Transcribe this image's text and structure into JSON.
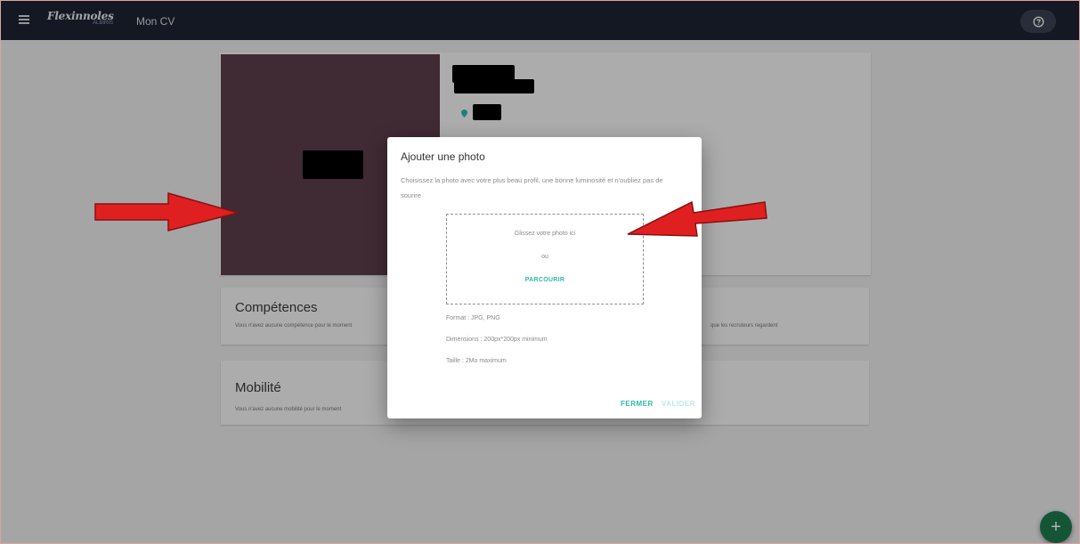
{
  "header": {
    "brand_main": "Flexinnoles",
    "brand_sub": "ALBIRIS",
    "page_title": "Mon CV"
  },
  "sections": {
    "competences_title": "Compétences",
    "competences_text": "Vous n'avez aucune compétence pour le moment",
    "competences_text_right": "que les recruteurs regardent",
    "mobilite_title": "Mobilité",
    "mobilite_text": "Vous n'avez aucune mobilité pour le moment"
  },
  "dialog": {
    "title": "Ajouter une photo",
    "description": "Choisissez la photo avec votre plus beau profil, une bonne luminosité et n'oubliez pas de sourire",
    "drop_text": "Glissez votre photo ici",
    "or_text": "ou",
    "browse_label": "PARCOURIR",
    "format": "Format : JPG, PNG",
    "dimensions": "Dimensions : 200px*200px minimum",
    "size": "Taille : 2Mo maximum",
    "close_label": "FERMER",
    "validate_label": "VALIDER"
  },
  "fab_label": "+",
  "colors": {
    "topbar": "#1e2331",
    "accent": "#2fb8a8",
    "photo_bg": "#5c3d49",
    "fab": "#1e7a4e",
    "annotation_arrow": "#e02020"
  },
  "icons": {
    "menu": "menu-icon",
    "help": "help-circle-icon",
    "location": "location-pin-icon",
    "add": "plus-icon"
  }
}
